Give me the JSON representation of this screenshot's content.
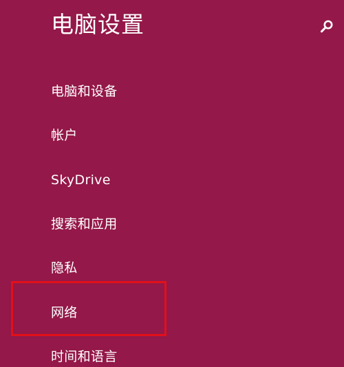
{
  "header": {
    "title": "电脑设置",
    "search_icon": "search-icon"
  },
  "nav": {
    "items": [
      {
        "label": "电脑和设备"
      },
      {
        "label": "帐户"
      },
      {
        "label": "SkyDrive"
      },
      {
        "label": "搜索和应用"
      },
      {
        "label": "隐私"
      },
      {
        "label": "网络"
      },
      {
        "label": "时间和语言"
      }
    ],
    "highlighted_item": "网络"
  },
  "colors": {
    "background": "#941849",
    "text": "#ffffff",
    "highlight_border": "#e3101a"
  }
}
